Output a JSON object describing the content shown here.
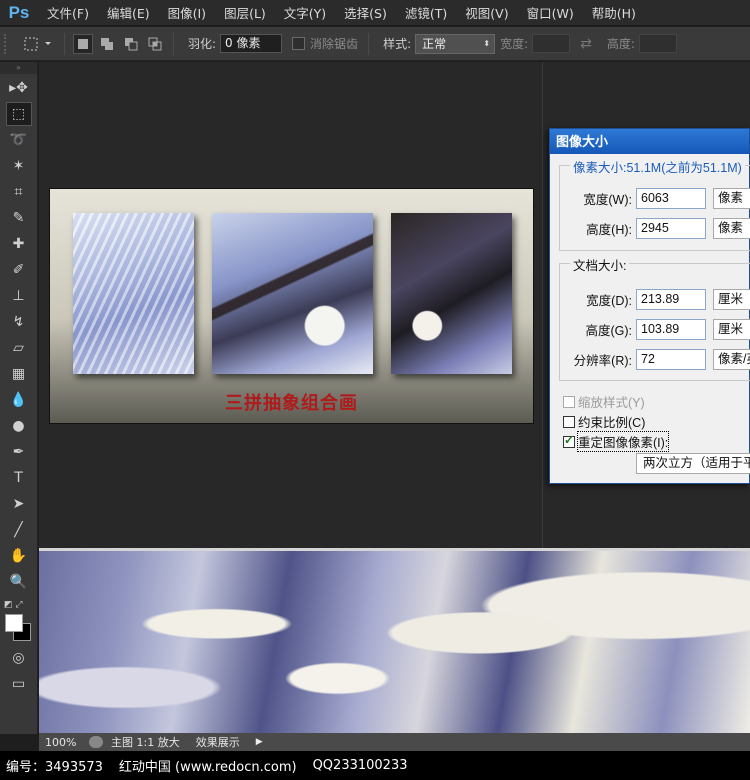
{
  "app": {
    "logo": "Ps"
  },
  "menu": [
    "文件(F)",
    "编辑(E)",
    "图像(I)",
    "图层(L)",
    "文字(Y)",
    "选择(S)",
    "滤镜(T)",
    "视图(V)",
    "窗口(W)",
    "帮助(H)"
  ],
  "options": {
    "feather_label": "羽化:",
    "feather_value": "0 像素",
    "antialias_label": "消除锯齿",
    "style_label": "样式:",
    "style_value": "正常",
    "width_label": "宽度:",
    "height_label": "高度:"
  },
  "tools": [
    {
      "name": "move-tool",
      "glyph": "▸✥"
    },
    {
      "name": "marquee-tool",
      "glyph": "⬚",
      "active": true
    },
    {
      "name": "lasso-tool",
      "glyph": "➰"
    },
    {
      "name": "magic-wand-tool",
      "glyph": "✶"
    },
    {
      "name": "crop-tool",
      "glyph": "⌗"
    },
    {
      "name": "eyedropper-tool",
      "glyph": "✎"
    },
    {
      "name": "healing-brush-tool",
      "glyph": "✚"
    },
    {
      "name": "brush-tool",
      "glyph": "✐"
    },
    {
      "name": "clone-stamp-tool",
      "glyph": "⊥"
    },
    {
      "name": "history-brush-tool",
      "glyph": "↯"
    },
    {
      "name": "eraser-tool",
      "glyph": "▱"
    },
    {
      "name": "gradient-tool",
      "glyph": "▦"
    },
    {
      "name": "blur-tool",
      "glyph": "💧"
    },
    {
      "name": "dodge-tool",
      "glyph": "●"
    },
    {
      "name": "pen-tool",
      "glyph": "✒"
    },
    {
      "name": "type-tool",
      "glyph": "T"
    },
    {
      "name": "path-selection-tool",
      "glyph": "➤"
    },
    {
      "name": "line-tool",
      "glyph": "╱"
    },
    {
      "name": "hand-tool",
      "glyph": "✋"
    },
    {
      "name": "zoom-tool",
      "glyph": "🔍"
    }
  ],
  "poster": {
    "title": "三拼抽象组合画"
  },
  "status": {
    "zoom": "100%",
    "layer": "主图 1:1 放大",
    "effect": "效果展示"
  },
  "footer": {
    "id": "编号：3493573",
    "site": "红动中国 (www.redocn.com)",
    "qq": "QQ233100233"
  },
  "dialog": {
    "title": "图像大小",
    "pixel_group": "像素大小:51.1M(之前为51.1M)",
    "px_width_label": "宽度(W):",
    "px_width_value": "6063",
    "px_width_unit": "像素",
    "px_height_label": "高度(H):",
    "px_height_value": "2945",
    "px_height_unit": "像素",
    "doc_group": "文档大小:",
    "doc_width_label": "宽度(D):",
    "doc_width_value": "213.89",
    "doc_width_unit": "厘米",
    "doc_height_label": "高度(G):",
    "doc_height_value": "103.89",
    "doc_height_unit": "厘米",
    "res_label": "分辨率(R):",
    "res_value": "72",
    "res_unit": "像素/英",
    "scale_styles": "缩放样式(Y)",
    "constrain": "约束比例(C)",
    "resample": "重定图像像素(I):",
    "resample_method": "两次立方（适用于平"
  }
}
